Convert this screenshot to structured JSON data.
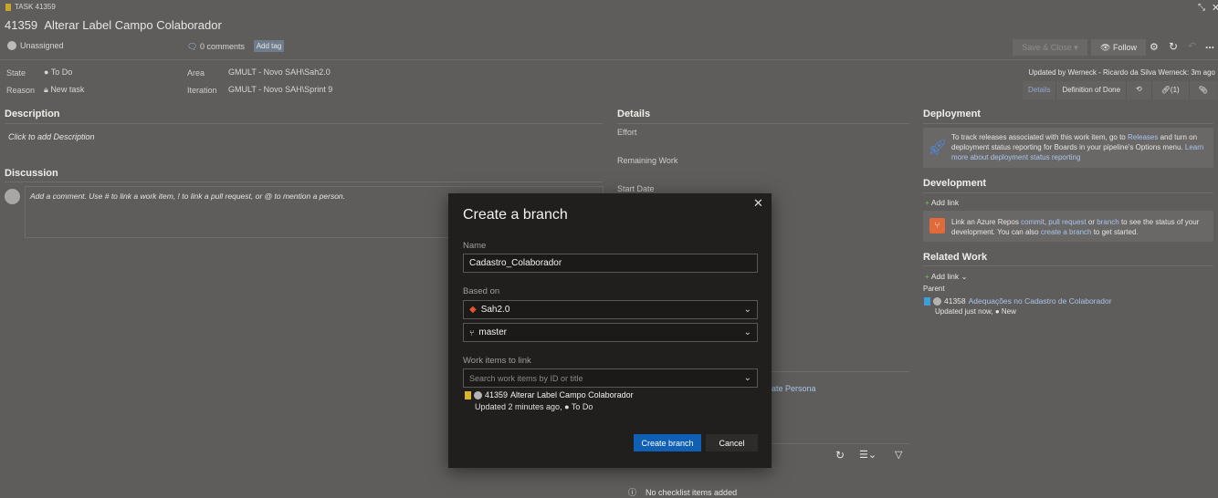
{
  "header": {
    "type_label": "TASK 41359",
    "id": "41359",
    "title": "Alterar Label Campo Colaborador",
    "assignee": "Unassigned",
    "comments": "0 comments",
    "add_tag": "Add tag"
  },
  "toolbar": {
    "save_close": "Save & Close",
    "follow": "Follow",
    "more": "..."
  },
  "fields": {
    "state_label": "State",
    "state": "To Do",
    "reason_label": "Reason",
    "reason": "New task",
    "area_label": "Area",
    "area": "GMULT - Novo SAH\\Sah2.0",
    "iteration_label": "Iteration",
    "iteration": "GMULT - Novo SAH\\Sprint 9"
  },
  "updated": "Updated by Werneck - Ricardo da Silva Werneck: 3m ago",
  "tabs": [
    {
      "label": "Details"
    },
    {
      "label": "Definition of Done"
    },
    {
      "label": "(1)"
    }
  ],
  "description": {
    "title": "Description",
    "placeholder": "Click to add Description"
  },
  "discussion": {
    "title": "Discussion",
    "placeholder": "Add a comment. Use # to link a work item, ! to link a pull request, or @ to mention a person."
  },
  "details": {
    "title": "Details",
    "effort": "Effort",
    "remaining": "Remaining Work",
    "start": "Start Date",
    "persona_link": "ate Persona",
    "checklist_empty": "No checklist items added"
  },
  "deployment": {
    "title": "Deployment",
    "text1": "To track releases associated with this work item, go to",
    "releases": "Releases",
    "text2": "and turn on deployment status reporting for Boards in your pipeline's Options menu.",
    "learn": "Learn more about deployment status reporting"
  },
  "development": {
    "title": "Development",
    "add_link": "Add link",
    "t1": "Link an Azure Repos",
    "commit": "commit",
    "pr": "pull request",
    "or": "or",
    "branch": "branch",
    "t2": "to see the status of your development. You can also",
    "create": "create a branch",
    "t3": "to get started."
  },
  "related": {
    "title": "Related Work",
    "add_link": "Add link",
    "parent_label": "Parent",
    "parent_id": "41358",
    "parent_title": "Adequações no Cadastro de Colaborador",
    "parent_updated": "Updated just now,",
    "parent_state": "New"
  },
  "dialog": {
    "title": "Create a branch",
    "name_label": "Name",
    "name_value": "Cadastro_Colaborador",
    "based_on_label": "Based on",
    "repo": "Sah2.0",
    "branch": "master",
    "work_items_label": "Work items to link",
    "search_placeholder": "Search work items by ID or title",
    "item_id": "41359",
    "item_title": "Alterar Label Campo Colaborador",
    "item_updated": "Updated 2 minutes ago,",
    "item_state": "To Do",
    "create_btn": "Create branch",
    "cancel_btn": "Cancel"
  },
  "colors": {
    "overlay_bg": "#5f5d5b",
    "dialog_bg": "#201f1e",
    "primary": "#0f5fb4",
    "repo_icon": "#e8542a",
    "task_icon": "#f2c811"
  }
}
